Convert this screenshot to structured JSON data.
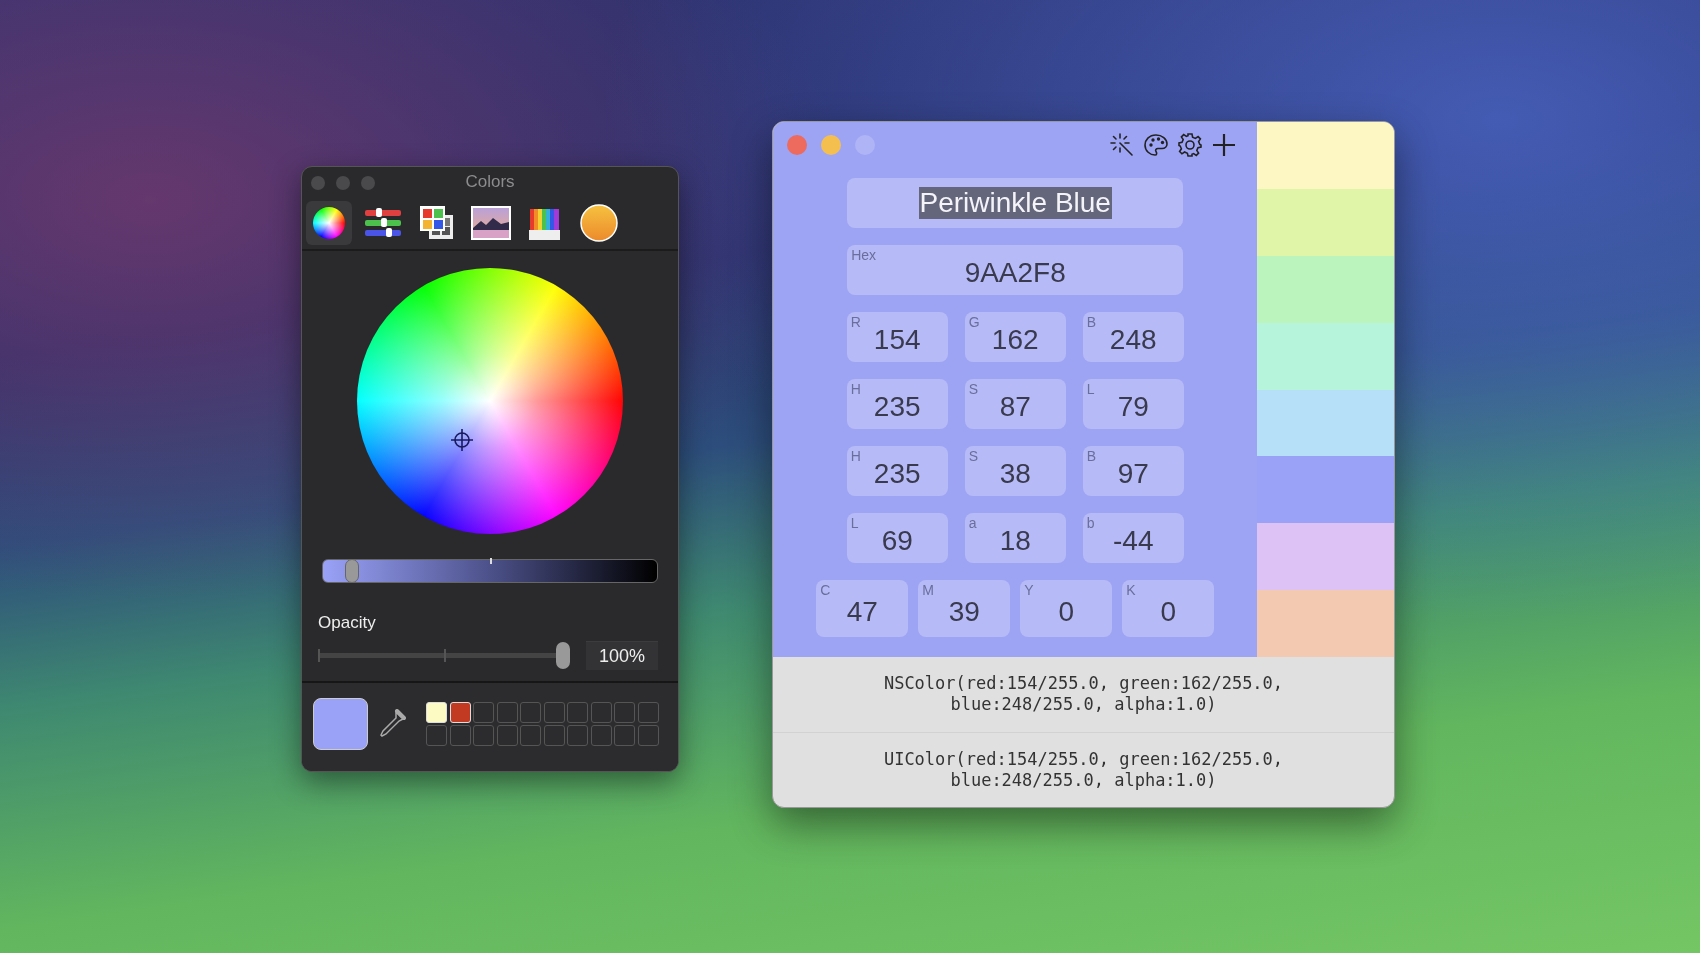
{
  "colors_panel": {
    "title": "Colors",
    "modes": [
      {
        "kind": "wheel",
        "selected": true
      },
      {
        "kind": "sliders",
        "selected": false
      },
      {
        "kind": "palettes",
        "selected": false
      },
      {
        "kind": "image",
        "selected": false
      },
      {
        "kind": "pencils",
        "selected": false
      },
      {
        "kind": "sphere",
        "selected": false
      }
    ],
    "brightness": {
      "level": 0.07
    },
    "opacity": {
      "label": "Opacity",
      "level": 1,
      "value": "100%"
    },
    "current_color": {
      "color": "#9aa2f8"
    },
    "swatches": [
      {
        "color": "#fdfbc4"
      },
      {
        "color": "#c23a22"
      }
    ]
  },
  "color_window": {
    "traffic_lights": [
      {
        "kind": "close",
        "disabled": false
      },
      {
        "kind": "minimize",
        "disabled": false
      },
      {
        "kind": "zoom",
        "disabled": true
      }
    ],
    "toolbar": [
      {
        "kind": "wand"
      },
      {
        "kind": "palette"
      },
      {
        "kind": "settings"
      },
      {
        "kind": "add"
      }
    ],
    "name_field": {
      "value": "Periwinkle Blue",
      "selected": true
    },
    "hex_field": {
      "label": "Hex",
      "value": "9AA2F8"
    },
    "component_rows": [
      {
        "fields": [
          {
            "label": "R",
            "value": "154"
          },
          {
            "label": "G",
            "value": "162"
          },
          {
            "label": "B",
            "value": "248"
          }
        ]
      },
      {
        "fields": [
          {
            "label": "H",
            "value": "235"
          },
          {
            "label": "S",
            "value": "87"
          },
          {
            "label": "L",
            "value": "79"
          }
        ]
      },
      {
        "fields": [
          {
            "label": "H",
            "value": "235"
          },
          {
            "label": "S",
            "value": "38"
          },
          {
            "label": "B",
            "value": "97"
          }
        ]
      },
      {
        "fields": [
          {
            "label": "L",
            "value": "69"
          },
          {
            "label": "a",
            "value": "18"
          },
          {
            "label": "b",
            "value": "-44"
          }
        ]
      },
      {
        "fields": [
          {
            "label": "C",
            "value": "47"
          },
          {
            "label": "M",
            "value": "39"
          },
          {
            "label": "Y",
            "value": "0"
          },
          {
            "label": "K",
            "value": "0"
          }
        ]
      }
    ],
    "swatch_strip": [
      {
        "color": "#fdf7c4"
      },
      {
        "color": "#e1f5a9"
      },
      {
        "color": "#bbf5bd"
      },
      {
        "color": "#b6f4dc"
      },
      {
        "color": "#b6dff8"
      },
      {
        "color": "#9aa2f8"
      },
      {
        "color": "#dcc2f5"
      },
      {
        "color": "#f3c9b1"
      }
    ],
    "code_snippets": [
      {
        "text": "NSColor(red:154/255.0, green:162/255.0,\nblue:248/255.0, alpha:1.0)"
      },
      {
        "text": "UIColor(red:154/255.0, green:162/255.0,\nblue:248/255.0, alpha:1.0)"
      }
    ]
  }
}
